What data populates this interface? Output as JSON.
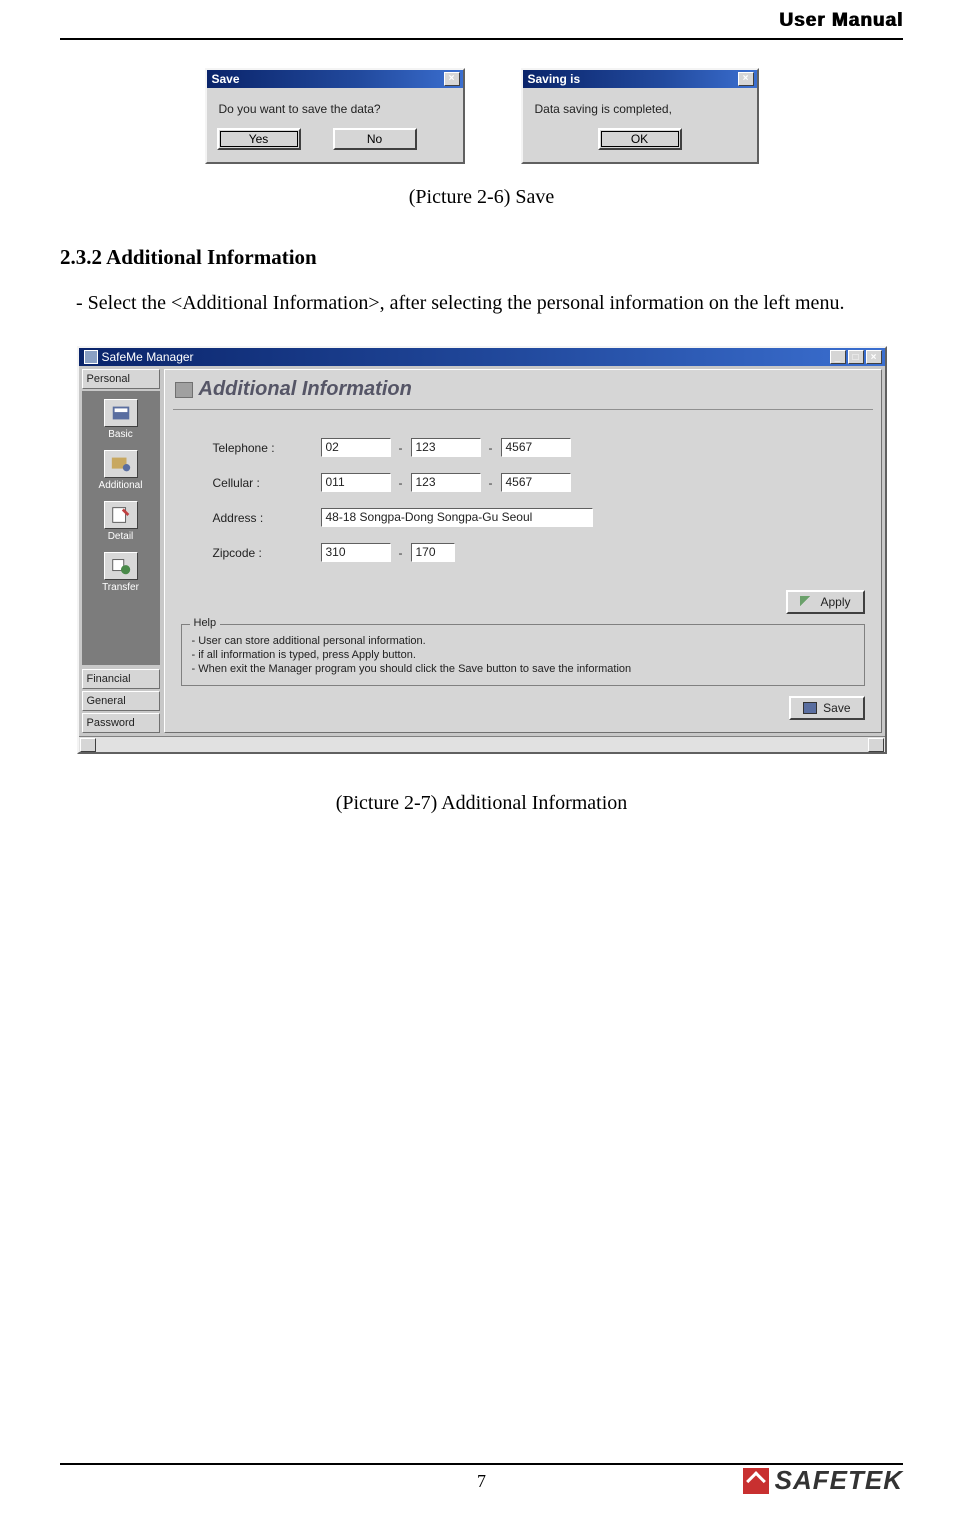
{
  "header": {
    "title": "User Manual"
  },
  "dialogs": {
    "save": {
      "title": "Save",
      "message": "Do you want to save the data?",
      "yes": "Yes",
      "no": "No"
    },
    "done": {
      "title": "Saving is",
      "message": "Data saving is completed,",
      "ok": "OK"
    }
  },
  "caption1": "(Picture 2-6) Save",
  "section": {
    "title": "2.3.2 Additional Information",
    "body": "- Select the <Additional Information>, after selecting the personal information on the left menu."
  },
  "app": {
    "title": "SafeMe Manager",
    "sidebar": {
      "personal": "Personal",
      "items": [
        {
          "label": "Basic"
        },
        {
          "label": "Additional"
        },
        {
          "label": "Detail"
        },
        {
          "label": "Transfer"
        }
      ],
      "financial": "Financial",
      "general": "General",
      "password": "Password"
    },
    "panel": {
      "title": "Additional Information",
      "labels": {
        "telephone": "Telephone :",
        "cellular": "Cellular :",
        "address": "Address :",
        "zipcode": "Zipcode :"
      },
      "values": {
        "tel1": "02",
        "tel2": "123",
        "tel3": "4567",
        "cel1": "011",
        "cel2": "123",
        "cel3": "4567",
        "address": "48-18  Songpa-Dong Songpa-Gu Seoul",
        "zip1": "310",
        "zip2": "170"
      },
      "apply": "Apply",
      "save": "Save",
      "help": {
        "legend": "Help",
        "l1": "- User can store additional personal information.",
        "l2": "- if all information is typed, press Apply button.",
        "l3": "- When exit the Manager program you should click the Save button to save the information"
      }
    }
  },
  "caption2": "(Picture 2-7) Additional Information",
  "footer": {
    "page": "7",
    "brand": "SAFETEK"
  }
}
